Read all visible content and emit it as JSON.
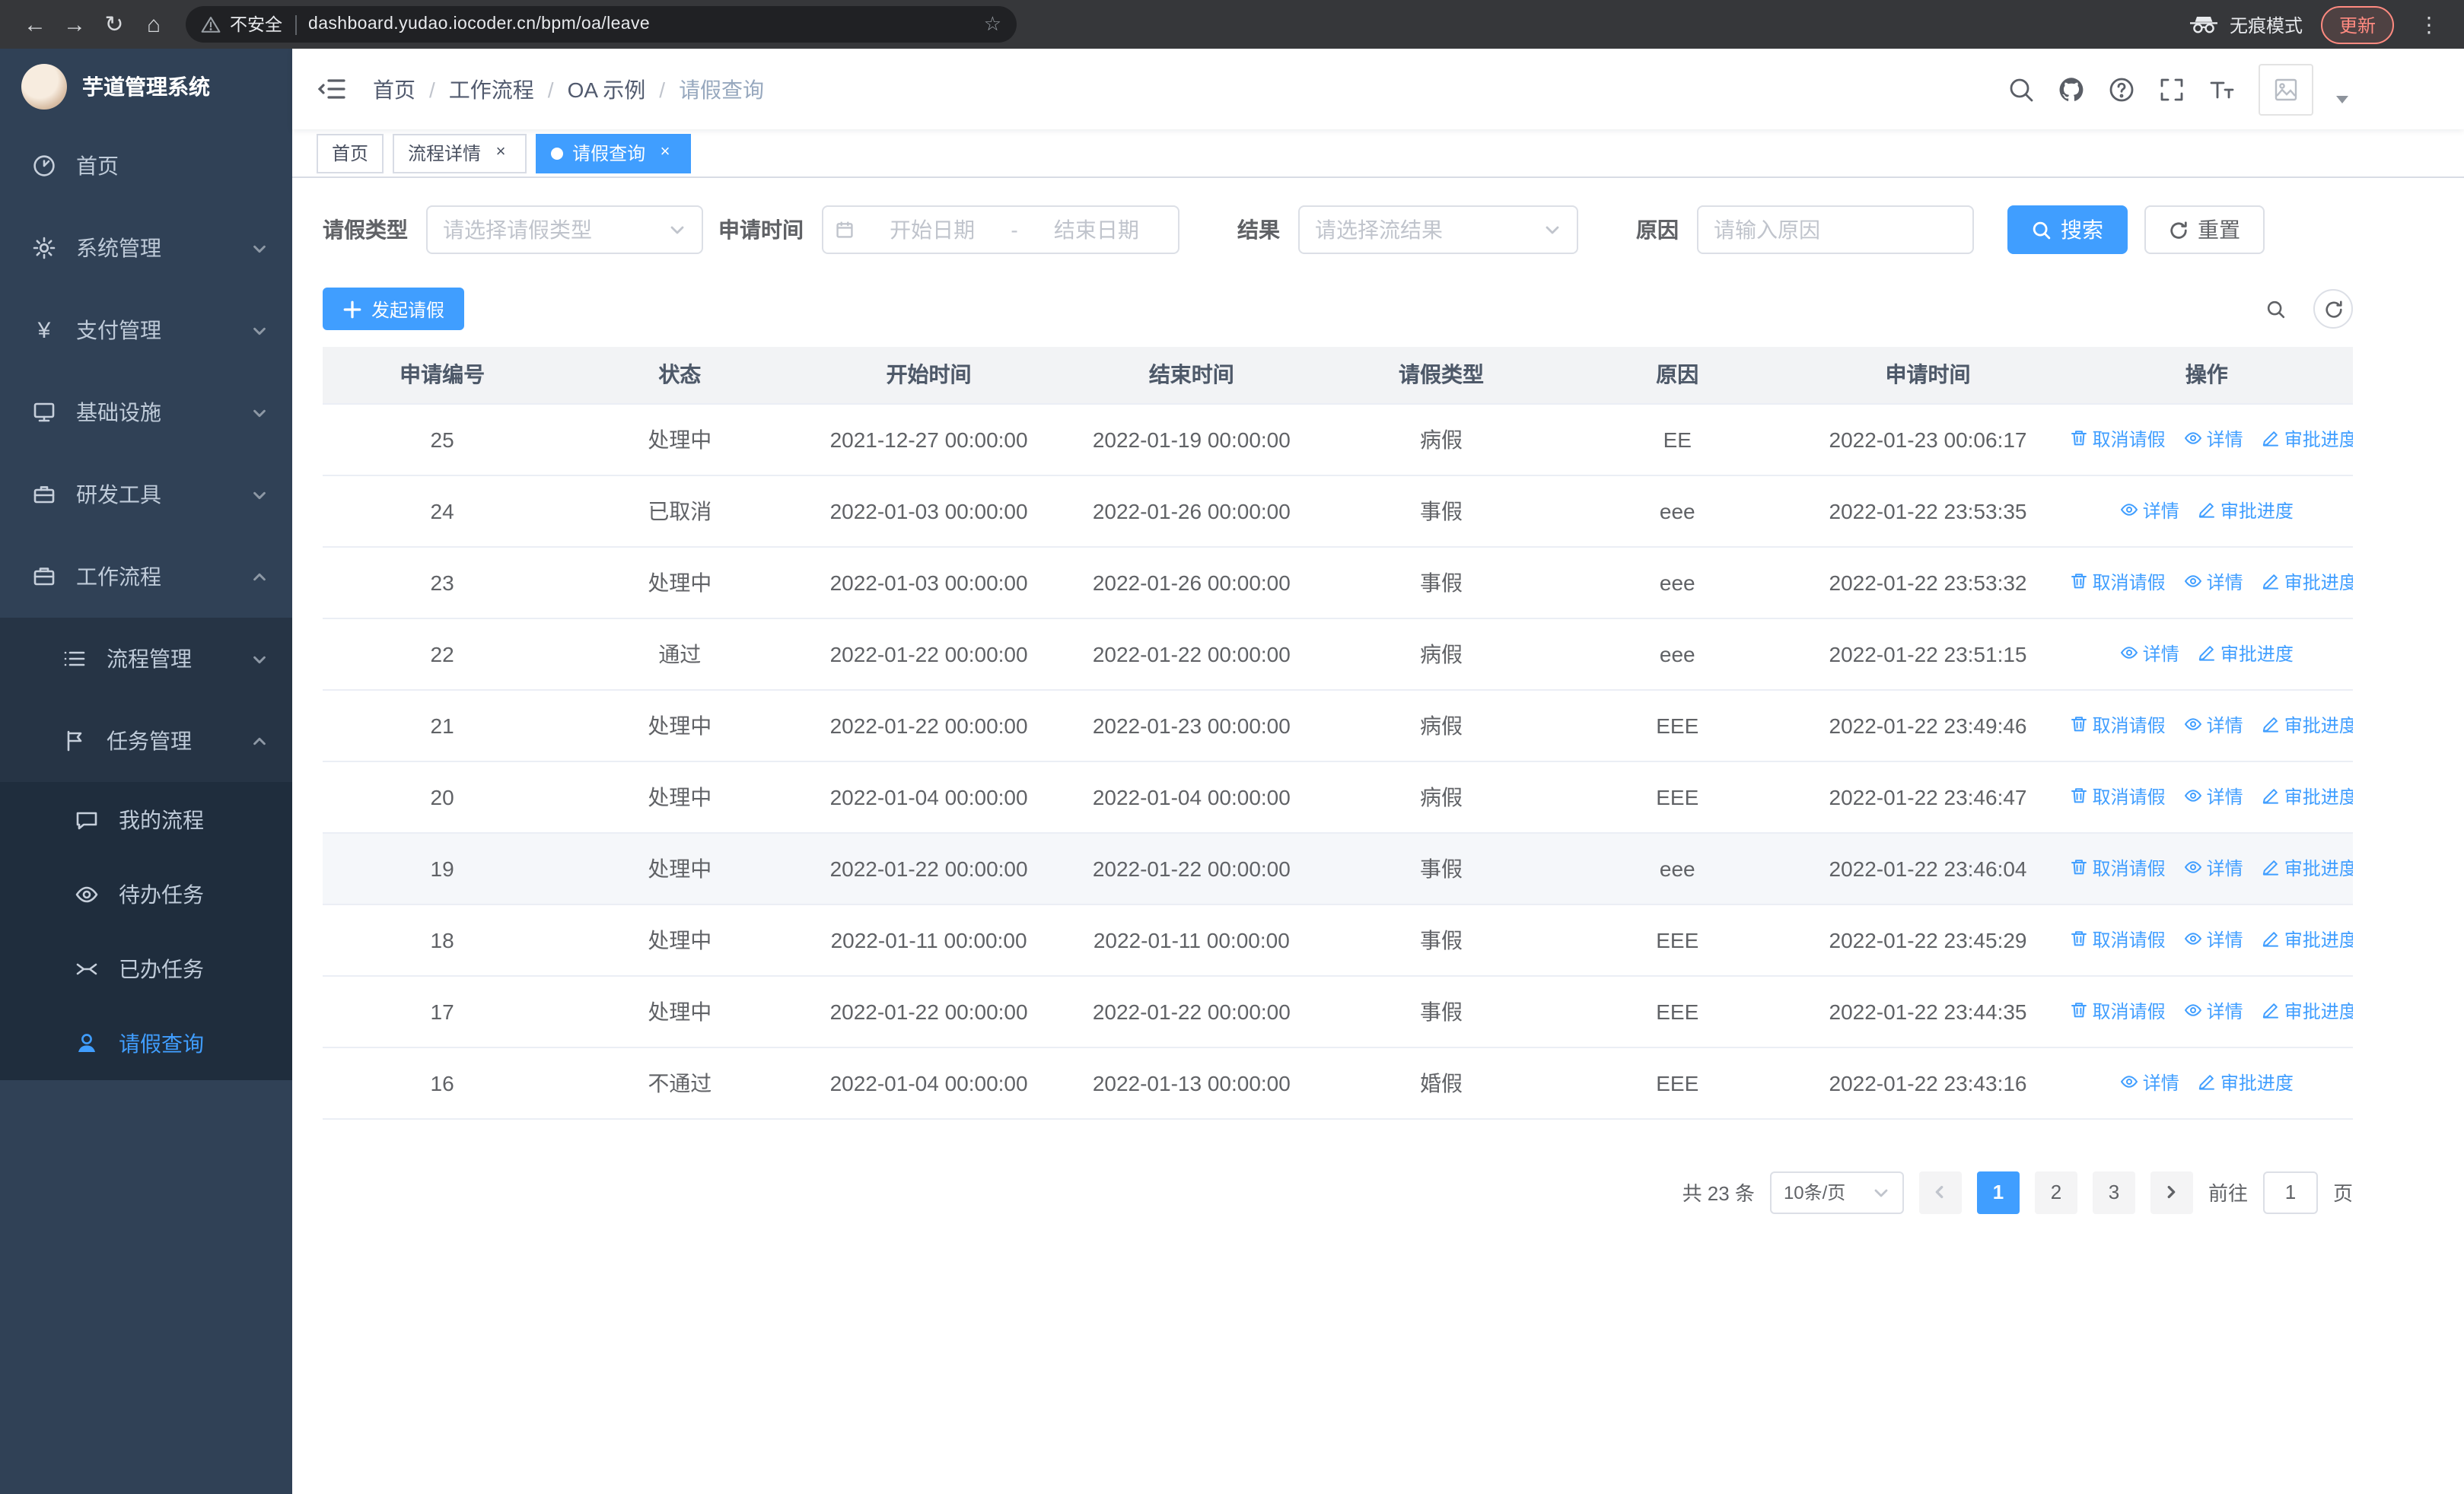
{
  "browser": {
    "url_warning": "不安全",
    "url": "dashboard.yudao.iocoder.cn/bpm/oa/leave",
    "incognito_label": "无痕模式",
    "update_label": "更新"
  },
  "sidebar": {
    "title": "芋道管理系统",
    "items": {
      "home": "首页",
      "system": "系统管理",
      "payment": "支付管理",
      "infra": "基础设施",
      "devtools": "研发工具",
      "workflow": "工作流程",
      "process_mgmt": "流程管理",
      "task_mgmt": "任务管理",
      "my_process": "我的流程",
      "todo_tasks": "待办任务",
      "done_tasks": "已办任务",
      "leave_query": "请假查询"
    }
  },
  "navbar": {
    "breadcrumb": [
      "首页",
      "工作流程",
      "OA 示例",
      "请假查询"
    ],
    "separator": "/"
  },
  "tabs": [
    {
      "label": "首页"
    },
    {
      "label": "流程详情"
    },
    {
      "label": "请假查询"
    }
  ],
  "filters": {
    "leave_type_label": "请假类型",
    "leave_type_placeholder": "请选择请假类型",
    "apply_time_label": "申请时间",
    "start_date_placeholder": "开始日期",
    "range_separator": "-",
    "end_date_placeholder": "结束日期",
    "result_label": "结果",
    "result_placeholder": "请选择流结果",
    "reason_label": "原因",
    "reason_placeholder": "请输入原因",
    "search_label": "搜索",
    "reset_label": "重置"
  },
  "toolbar": {
    "create_label": "发起请假"
  },
  "table": {
    "columns": [
      "申请编号",
      "状态",
      "开始时间",
      "结束时间",
      "请假类型",
      "原因",
      "申请时间",
      "操作"
    ],
    "action_labels": {
      "cancel": "取消请假",
      "detail": "详情",
      "progress": "审批进度"
    },
    "rows": [
      {
        "id": "25",
        "status": "处理中",
        "start": "2021-12-27 00:00:00",
        "end": "2022-01-19 00:00:00",
        "type": "病假",
        "reason": "EE",
        "applied": "2022-01-23 00:06:17",
        "actions": [
          "cancel",
          "detail",
          "progress"
        ]
      },
      {
        "id": "24",
        "status": "已取消",
        "start": "2022-01-03 00:00:00",
        "end": "2022-01-26 00:00:00",
        "type": "事假",
        "reason": "eee",
        "applied": "2022-01-22 23:53:35",
        "actions": [
          "detail",
          "progress"
        ]
      },
      {
        "id": "23",
        "status": "处理中",
        "start": "2022-01-03 00:00:00",
        "end": "2022-01-26 00:00:00",
        "type": "事假",
        "reason": "eee",
        "applied": "2022-01-22 23:53:32",
        "actions": [
          "cancel",
          "detail",
          "progress"
        ]
      },
      {
        "id": "22",
        "status": "通过",
        "start": "2022-01-22 00:00:00",
        "end": "2022-01-22 00:00:00",
        "type": "病假",
        "reason": "eee",
        "applied": "2022-01-22 23:51:15",
        "actions": [
          "detail",
          "progress"
        ]
      },
      {
        "id": "21",
        "status": "处理中",
        "start": "2022-01-22 00:00:00",
        "end": "2022-01-23 00:00:00",
        "type": "病假",
        "reason": "EEE",
        "applied": "2022-01-22 23:49:46",
        "actions": [
          "cancel",
          "detail",
          "progress"
        ]
      },
      {
        "id": "20",
        "status": "处理中",
        "start": "2022-01-04 00:00:00",
        "end": "2022-01-04 00:00:00",
        "type": "病假",
        "reason": "EEE",
        "applied": "2022-01-22 23:46:47",
        "actions": [
          "cancel",
          "detail",
          "progress"
        ]
      },
      {
        "id": "19",
        "status": "处理中",
        "start": "2022-01-22 00:00:00",
        "end": "2022-01-22 00:00:00",
        "type": "事假",
        "reason": "eee",
        "applied": "2022-01-22 23:46:04",
        "actions": [
          "cancel",
          "detail",
          "progress"
        ],
        "hover": true
      },
      {
        "id": "18",
        "status": "处理中",
        "start": "2022-01-11 00:00:00",
        "end": "2022-01-11 00:00:00",
        "type": "事假",
        "reason": "EEE",
        "applied": "2022-01-22 23:45:29",
        "actions": [
          "cancel",
          "detail",
          "progress"
        ]
      },
      {
        "id": "17",
        "status": "处理中",
        "start": "2022-01-22 00:00:00",
        "end": "2022-01-22 00:00:00",
        "type": "事假",
        "reason": "EEE",
        "applied": "2022-01-22 23:44:35",
        "actions": [
          "cancel",
          "detail",
          "progress"
        ]
      },
      {
        "id": "16",
        "status": "不通过",
        "start": "2022-01-04 00:00:00",
        "end": "2022-01-13 00:00:00",
        "type": "婚假",
        "reason": "EEE",
        "applied": "2022-01-22 23:43:16",
        "actions": [
          "detail",
          "progress"
        ]
      }
    ]
  },
  "pagination": {
    "total_label": "共 23 条",
    "page_size": "10条/页",
    "pages": [
      "1",
      "2",
      "3"
    ],
    "active_page": "1",
    "goto_label": "前往",
    "goto_value": "1",
    "goto_suffix": "页"
  },
  "colors": {
    "primary": "#409eff",
    "sidebar_bg": "#304156",
    "chrome_bg": "#36373a"
  }
}
